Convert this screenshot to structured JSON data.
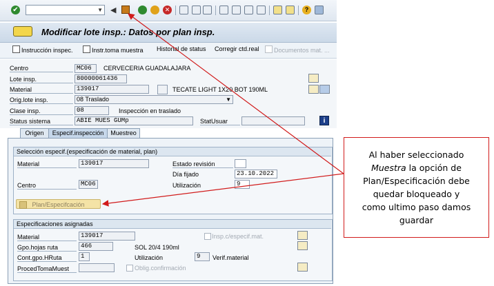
{
  "command_field": {
    "value": ""
  },
  "title": {
    "text": "Modificar lote insp.: Datos por plan insp."
  },
  "app_toolbar": {
    "instruccion": "Instrucción inspec.",
    "instr_toma": "Instr.toma muestra",
    "historial": "Historial de status",
    "corregir": "Corregir ctd.real",
    "documentos": "Documentos mat. ..."
  },
  "header": {
    "centro_label": "Centro",
    "centro_value": "MC06",
    "centro_text": "CERVECERIA GUADALAJARA",
    "lote_label": "Lote insp.",
    "lote_value": "80000061436",
    "material_label": "Material",
    "material_value": "139017",
    "material_text": "TECATE LIGHT  1X20 BOT 190ML",
    "orig_label": "Orig.lote insp.",
    "orig_value": "08 Traslado",
    "clase_label": "Clase insp.",
    "clase_value": "08",
    "clase_text": "Inspección en traslado",
    "status_label": "Status sistema",
    "status_value": "ABIE MUES GUMp",
    "statusu_label": "StatUsuar"
  },
  "tabs": [
    {
      "label": "Origen"
    },
    {
      "label": "Especif.inspección"
    },
    {
      "label": "Muestreo"
    }
  ],
  "selection_group": {
    "title": "Selección especif.(especificación de material, plan)",
    "material_label": "Material",
    "material_value": "139017",
    "estado_label": "Estado revisión",
    "dia_label": "Día fijado",
    "dia_value": "23.10.2022",
    "centro_label": "Centro",
    "centro_value": "MC06",
    "utilizacion_label": "Utilización",
    "utilizacion_value": "9",
    "plan_button": "Plan/Especifcación"
  },
  "assigned_group": {
    "title": "Especificaciones asignadas",
    "material_label": "Material",
    "material_value": "139017",
    "insp_label": "Insp.c/especif.mat.",
    "gpo_label": "Gpo.hojas ruta",
    "gpo_value": "466",
    "gpo_text": "SOL 20/4 190ml",
    "cont_label": "Cont.gpo.HRuta",
    "cont_value": "1",
    "util_label": "Utilización",
    "util_value": "9",
    "verif_label": "Verif.material",
    "proced_label": "ProcedTomaMuest",
    "oblig_label": "Oblig.confirmación"
  },
  "callout": {
    "line1": "Al haber seleccionado",
    "line2_italic": "Muestra",
    "line2_rest": " la opción de",
    "line3": "Plan/Especificación debe",
    "line4": "quedar bloqueado y",
    "line5": "como ultimo paso damos",
    "line6": "guardar"
  },
  "colors": {
    "accent_red": "#d11a1a",
    "sap_blue": "#dfe8f2",
    "button_yellow": "#f4e3a6"
  }
}
